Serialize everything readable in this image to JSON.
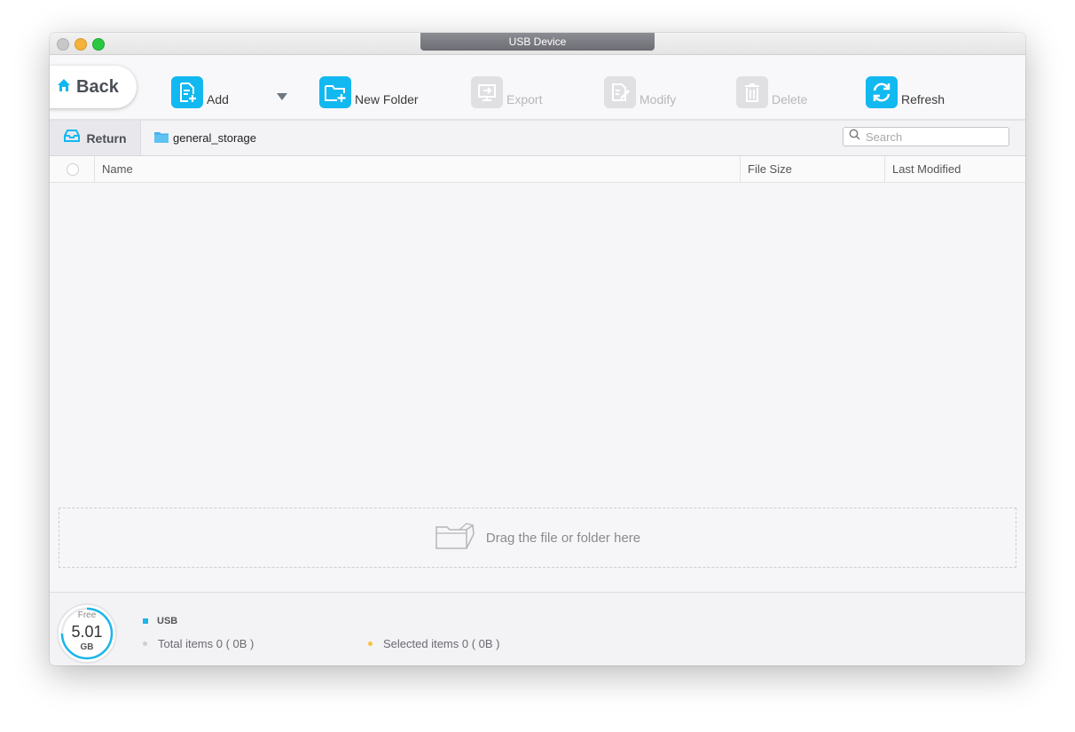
{
  "window": {
    "title": "USB Device"
  },
  "toolbar": {
    "back_label": "Back",
    "add_label": "Add",
    "new_folder_label": "New Folder",
    "export_label": "Export",
    "modify_label": "Modify",
    "delete_label": "Delete",
    "refresh_label": "Refresh"
  },
  "pathbar": {
    "return_label": "Return",
    "current_folder": "general_storage"
  },
  "search": {
    "placeholder": "Search",
    "value": ""
  },
  "table": {
    "columns": {
      "name": "Name",
      "size": "File Size",
      "modified": "Last Modified"
    },
    "rows": []
  },
  "dropzone": {
    "text": "Drag the file or folder here"
  },
  "storage": {
    "free_label": "Free",
    "free_value": "5.01",
    "free_unit": "GB",
    "device_label": "USB",
    "total_items": "Total items 0 ( 0B )",
    "selected_items": "Selected items 0 ( 0B )"
  },
  "colors": {
    "accent": "#12b8f0",
    "disabled_icon": "#e0e0e3",
    "selected_dot": "#f5c242",
    "total_dot": "#cfcfd3"
  }
}
